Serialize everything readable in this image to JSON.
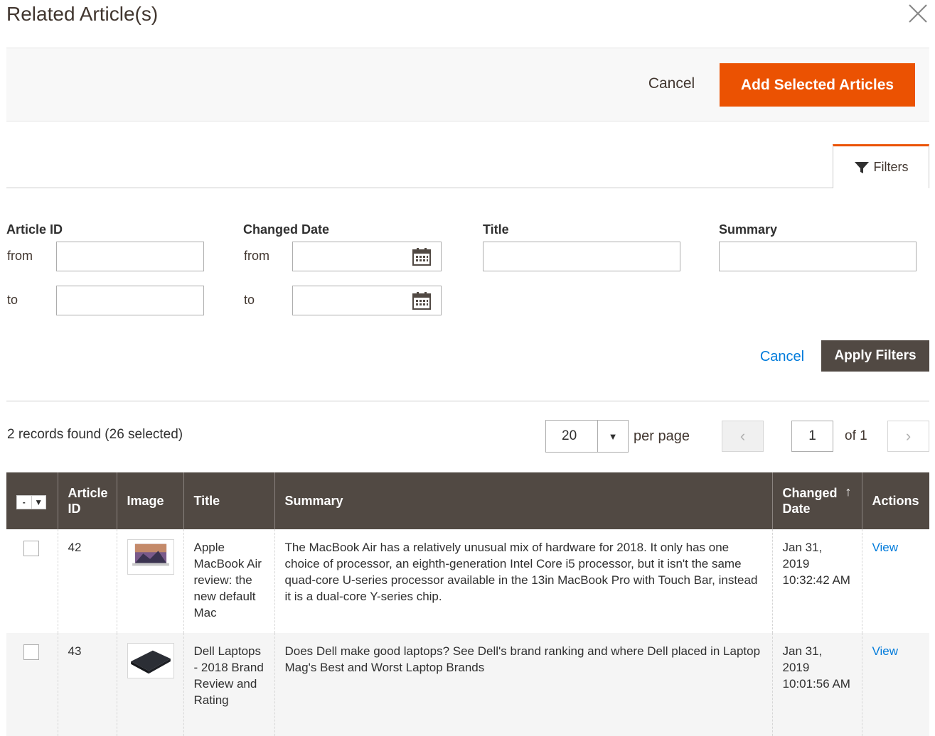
{
  "modal": {
    "title": "Related Article(s)",
    "close_icon": "close-icon"
  },
  "actions": {
    "cancel_label": "Cancel",
    "add_label": "Add Selected Articles"
  },
  "filters_tab": {
    "label": "Filters",
    "icon": "filter-icon"
  },
  "filters": {
    "article_id": {
      "label": "Article ID",
      "from_label": "from",
      "to_label": "to",
      "from_value": "",
      "to_value": ""
    },
    "changed_date": {
      "label": "Changed Date",
      "from_label": "from",
      "to_label": "to",
      "from_value": "",
      "to_value": "",
      "icon": "calendar-icon"
    },
    "title": {
      "label": "Title",
      "value": ""
    },
    "summary": {
      "label": "Summary",
      "value": ""
    },
    "cancel_label": "Cancel",
    "apply_label": "Apply Filters"
  },
  "grid_toolbar": {
    "records_text": "2 records found (26 selected)",
    "per_page_value": "20",
    "per_page_label": "per page",
    "page_value": "1",
    "page_of": "of 1"
  },
  "table": {
    "columns": [
      "Article ID",
      "Image",
      "Title",
      "Summary",
      "Changed Date",
      "Actions"
    ],
    "rows": [
      {
        "id": "42",
        "title": "Apple MacBook Air review: the new default Mac",
        "summary": "The MacBook Air has a relatively unusual mix of hardware for 2018. It only has one choice of processor, an eighth-generation Intel Core i5 processor, but it isn't the same quad-core U-series processor available in the 13in MacBook Pro with Touch Bar, instead it is a dual-core Y-series chip.",
        "date": "Jan 31, 2019 10:32:42 AM",
        "action": "View"
      },
      {
        "id": "43",
        "title": "Dell Laptops - 2018 Brand Review and Rating",
        "summary": "Does Dell make good laptops? See Dell's brand ranking and where Dell placed in Laptop Mag's Best and Worst Laptop Brands",
        "date": "Jan 31, 2019 10:01:56 AM",
        "action": "View"
      }
    ]
  },
  "colors": {
    "accent": "#eb5202",
    "header_bg": "#514943",
    "link": "#007bdb"
  }
}
